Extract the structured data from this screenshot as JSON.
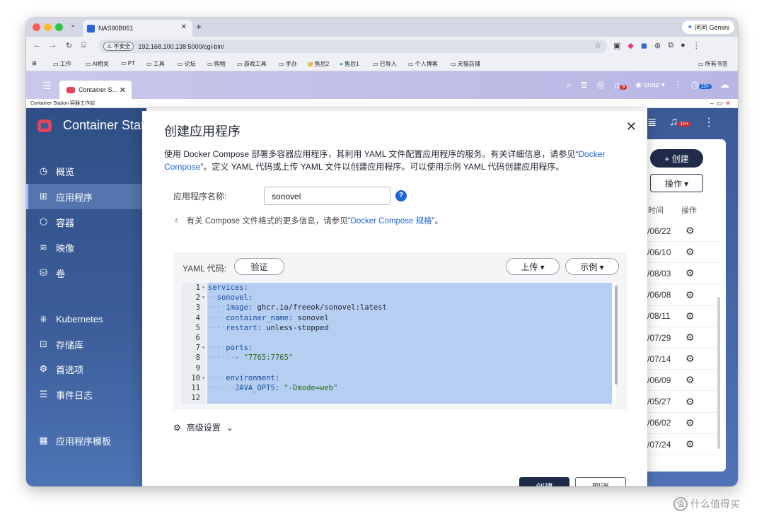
{
  "browser": {
    "tab_title": "NAS90B051",
    "new_tab": "+",
    "gemini_label": "问问 Gemini",
    "insecure_label": "不安全",
    "url": "192.168.100.138:5000/cgi-bin/",
    "bookmarks": [
      "工作",
      "AI相关",
      "PT",
      "工具",
      "论坛",
      "购物",
      "游戏工具",
      "手办",
      "售后2",
      "售后1",
      "已导入",
      "个人博客",
      "天猫店铺"
    ],
    "all_bookmarks": "所有书签"
  },
  "qnap": {
    "app_tab": "Container S...",
    "user": "qnap",
    "notif_count": "9",
    "bubble_count": "10+",
    "appbar_title": "Container Station 容器工作站"
  },
  "sidebar": {
    "title": "Container Station",
    "items": [
      {
        "label": "概览",
        "icon": "speedometer-icon"
      },
      {
        "label": "应用程序",
        "icon": "apps-icon"
      },
      {
        "label": "容器",
        "icon": "cube-icon"
      },
      {
        "label": "映像",
        "icon": "layers-icon"
      },
      {
        "label": "卷",
        "icon": "database-icon"
      },
      {
        "label": "Kubernetes",
        "icon": "kubernetes-icon"
      },
      {
        "label": "存储库",
        "icon": "registry-icon"
      },
      {
        "label": "首选项",
        "icon": "preferences-icon"
      },
      {
        "label": "事件日志",
        "icon": "log-icon"
      },
      {
        "label": "应用程序模板",
        "icon": "template-icon"
      }
    ]
  },
  "right_panel": {
    "top_badge": "10+",
    "create_label": "+ 创建",
    "ops_label": "操作 ▾",
    "col_time": "时间",
    "col_ops": "操作",
    "dates": [
      "/06/22",
      "/06/10",
      "/08/03",
      "/06/08",
      "/08/11",
      "/07/29",
      "/07/14",
      "/06/09",
      "/05/27",
      "/06/02",
      "/07/24"
    ]
  },
  "modal": {
    "title": "创建应用程序",
    "desc_1": "使用 Docker Compose 部署多容器应用程序，其利用 YAML 文件配置应用程序的服务。有关详细信息，请参见“",
    "desc_link": "Docker Compose",
    "desc_2": "”。定义 YAML 代码或上传 YAML 文件以创建应用程序。可以使用示例 YAML 代码创建应用程序。",
    "name_label": "应用程序名称:",
    "name_value": "sonovel",
    "tip_1": "有关 Compose 文件格式的更多信息，请参见“",
    "tip_link": "Docker Compose 规格",
    "tip_2": "”。",
    "yaml_label": "YAML 代码:",
    "validate_label": "验证",
    "upload_label": "上传 ▾",
    "example_label": "示例 ▾",
    "advanced_label": "高级设置",
    "create_label": "创建",
    "cancel_label": "取消",
    "yaml_lines": [
      {
        "n": "1",
        "fold": true,
        "indent": "",
        "key": "services:",
        "val": ""
      },
      {
        "n": "2",
        "fold": true,
        "indent": "··",
        "key": "sonovel:",
        "val": ""
      },
      {
        "n": "3",
        "fold": false,
        "indent": "····",
        "key": "image:",
        "val": " ghcr.io/freeok/sonovel:latest"
      },
      {
        "n": "4",
        "fold": false,
        "indent": "····",
        "key": "container_name:",
        "val": " sonovel"
      },
      {
        "n": "5",
        "fold": false,
        "indent": "····",
        "key": "restart:",
        "val": " unless-stopped"
      },
      {
        "n": "6",
        "fold": false,
        "indent": "",
        "key": "",
        "val": ""
      },
      {
        "n": "7",
        "fold": true,
        "indent": "····",
        "key": "ports:",
        "val": ""
      },
      {
        "n": "8",
        "fold": false,
        "indent": "······",
        "key": "- ",
        "val": "\"7765:7765\""
      },
      {
        "n": "9",
        "fold": false,
        "indent": "",
        "key": "",
        "val": ""
      },
      {
        "n": "10",
        "fold": true,
        "indent": "····",
        "key": "environment:",
        "val": ""
      },
      {
        "n": "11",
        "fold": false,
        "indent": "······",
        "key": "JAVA_OPTS:",
        "val": " \"-Dmode=web\""
      },
      {
        "n": "12",
        "fold": false,
        "indent": "",
        "key": "",
        "val": ""
      }
    ]
  },
  "watermark": "什么值得买"
}
